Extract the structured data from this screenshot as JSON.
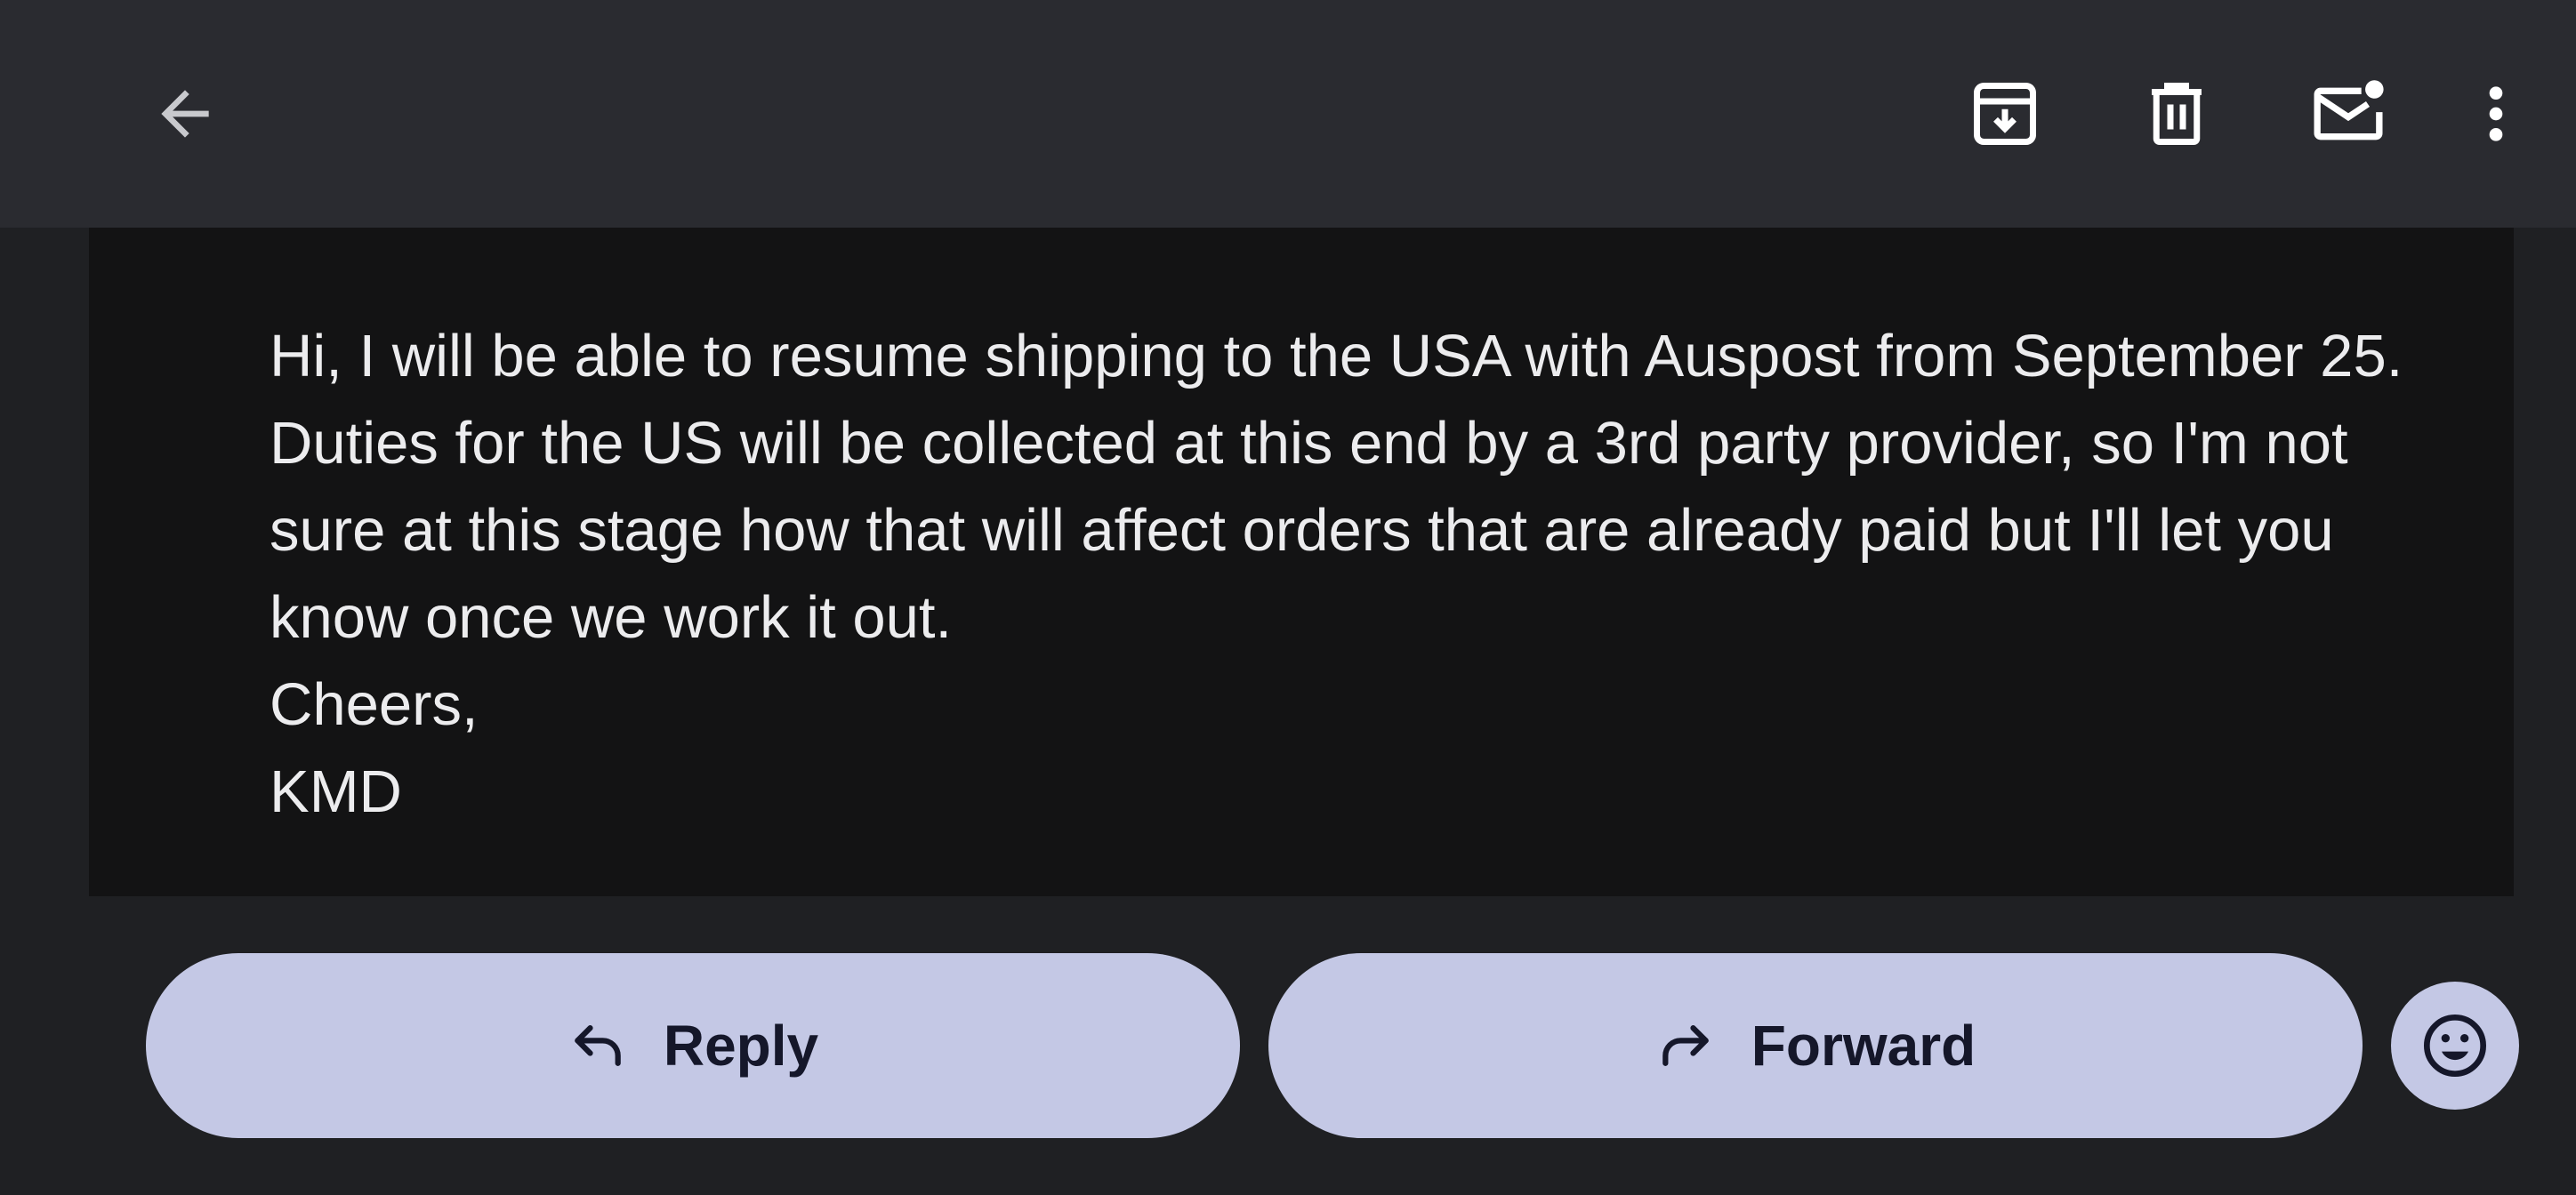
{
  "toolbar": {
    "back_icon": "arrow-left-icon",
    "archive_icon": "archive-icon",
    "delete_icon": "trash-icon",
    "mark_unread_icon": "mail-unread-icon",
    "more_icon": "more-vert-icon"
  },
  "message": {
    "body": [
      "Hi, I will be able to resume shipping to the USA with Auspost from September 25. Duties for the US will be collected at this end by a 3rd party provider, so I'm not sure at this stage how that will affect orders that are already paid but I'll let you know once we work it out.",
      "Cheers,",
      "KMD"
    ]
  },
  "actions": {
    "reply_label": "Reply",
    "forward_label": "Forward",
    "reply_icon": "reply-icon",
    "forward_icon": "forward-icon",
    "emoji_icon": "emoji-icon"
  },
  "colors": {
    "background": "#1f2023",
    "topbar": "#2a2b30",
    "card": "#131314",
    "button": "#c4c8e5",
    "button_text": "#15172a",
    "body_text": "#ececee"
  }
}
